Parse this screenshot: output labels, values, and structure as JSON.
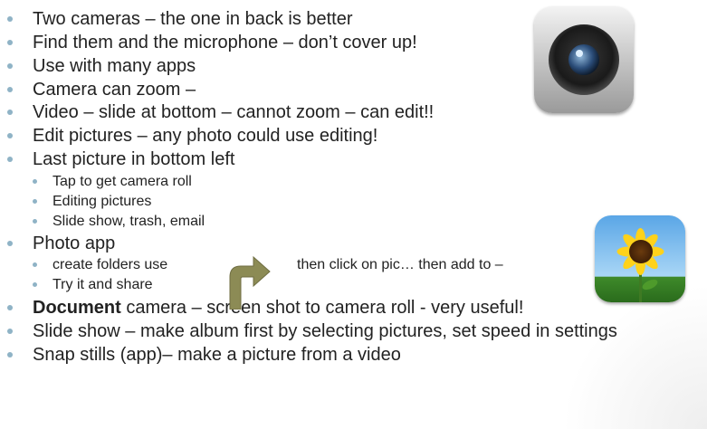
{
  "slide": {
    "bullets": [
      {
        "level": 1,
        "text": "Two cameras – the one in back is better"
      },
      {
        "level": 1,
        "text": "Find them and the microphone – don’t cover up!"
      },
      {
        "level": 1,
        "text": "Use with many apps"
      },
      {
        "level": 1,
        "text": "Camera can zoom –"
      },
      {
        "level": 1,
        "text": "Video – slide at bottom – cannot zoom – can edit!!"
      },
      {
        "level": 1,
        "text": "Edit pictures – any photo could use editing!"
      },
      {
        "level": 1,
        "text": "Last picture in bottom left"
      },
      {
        "level": 2,
        "text": "Tap to get camera roll"
      },
      {
        "level": 2,
        "text": "Editing pictures"
      },
      {
        "level": 2,
        "text": "Slide show, trash, email"
      },
      {
        "level": 1,
        "text": "Photo app"
      },
      {
        "level": 2,
        "text_a": "create folders use",
        "text_b": "then click on pic… then add to –"
      },
      {
        "level": 2,
        "text": "Try it and share"
      },
      {
        "level": 1,
        "bold": "Document",
        "text": " camera – screen shot to camera roll  - very useful!"
      },
      {
        "level": 1,
        "text": "Slide show – make album first by selecting pictures, set speed in settings"
      },
      {
        "level": 1,
        "text": "Snap stills (app)– make a picture from a video"
      }
    ]
  },
  "icons": {
    "camera": "camera-app-icon",
    "photos": "photos-app-icon",
    "arrow": "curved-arrow-icon"
  },
  "colors": {
    "bullet": "#8fb3c6",
    "arrow_fill": "#8c8b55"
  }
}
